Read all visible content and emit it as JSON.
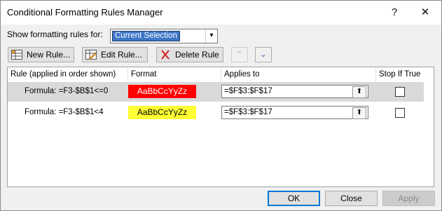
{
  "window": {
    "title": "Conditional Formatting Rules Manager",
    "help_glyph": "?",
    "close_glyph": "✕"
  },
  "show_rules": {
    "label": "Show formatting rules for:",
    "selected": "Current Selection"
  },
  "toolbar": {
    "new_rule": "New Rule...",
    "edit_rule": "Edit Rule...",
    "delete_rule": "Delete Rule",
    "move_up_glyph": "⌃",
    "move_down_glyph": "⌄"
  },
  "table": {
    "headers": {
      "rule": "Rule (applied in order shown)",
      "format": "Format",
      "applies": "Applies to",
      "stop": "Stop If True"
    },
    "rows": [
      {
        "rule": "Formula: =F3-$B$1<=0",
        "preview": "AaBbCcYyZz",
        "preview_bg": "#ff0000",
        "preview_color": "#ffffff",
        "applies": "=$F$3:$F$17",
        "stop_if_true": false
      },
      {
        "rule": "Formula: =F3-$B$1<4",
        "preview": "AaBbCcYyZz",
        "preview_bg": "#ffff33",
        "preview_color": "#000000",
        "applies": "=$F$3:$F$17",
        "stop_if_true": false
      }
    ]
  },
  "footer": {
    "ok": "OK",
    "close": "Close",
    "apply": "Apply"
  },
  "colors": {
    "selected_row": "#d9d9d9",
    "accent": "#0078d7"
  }
}
